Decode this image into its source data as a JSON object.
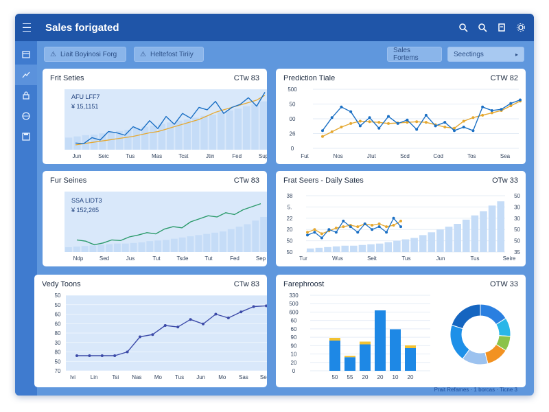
{
  "app": {
    "title": "Sales forigated",
    "footer": "Prait Refames · 1 borcas · Ticne 3"
  },
  "toolbar": {
    "btn1": "Liait Boyinosi Forg",
    "btn2": "Heltefost Tiriiy",
    "btn3": "Sales Fortems",
    "btn4": "Seectings"
  },
  "icons": {
    "titlebar": [
      "search-icon",
      "zoom-icon",
      "bookmark-icon",
      "gear-icon"
    ],
    "sidebar": [
      "calendar-icon",
      "chart-icon",
      "lock-icon",
      "globe-icon",
      "save-icon"
    ]
  },
  "colors": {
    "titlebar": "#1f55a8",
    "line_primary": "#1a6fc4",
    "line_secondary": "#e5a830",
    "line_green": "#2a9a6a",
    "line_purple": "#3c4aa8",
    "bar": "#c5dcf7"
  },
  "panels": {
    "p1": {
      "title": "Frit Seties",
      "tag": "CTw 83",
      "legend1": "AFU LFF7",
      "legend2": "¥ 15,1151"
    },
    "p2": {
      "title": "Prediction Tiale",
      "tag": "CTW 82"
    },
    "p3": {
      "title": "Fur Seines",
      "tag": "CTw 83",
      "legend1": "SSA LIDT3",
      "legend2": "¥ 152,265"
    },
    "p4": {
      "title": "Frat Seers - Daily Sates",
      "tag": "OTw 33"
    },
    "p5": {
      "title": "Vedy Toons",
      "tag": "CTw 83"
    },
    "p6": {
      "title": "Farephroost",
      "tag": "OTW 33"
    }
  },
  "chart_data": [
    {
      "id": "p1",
      "type": "line",
      "x": [
        "Jun",
        "Seic",
        "Tus",
        "Mas",
        "Tcst",
        "Jtin",
        "Fed",
        "Sup"
      ],
      "series": [
        {
          "values": [
            11,
            10,
            20,
            16,
            30,
            28,
            24,
            38,
            32,
            48,
            35,
            55,
            42,
            60,
            52,
            70,
            66,
            80,
            60,
            70,
            75,
            86,
            72,
            95
          ]
        },
        {
          "values": [
            8,
            10,
            12,
            14,
            16,
            18,
            20,
            22,
            25,
            28,
            30,
            34,
            38,
            42,
            46,
            50,
            56,
            62,
            66,
            70,
            74,
            78,
            82,
            90
          ]
        }
      ],
      "bars": [
        20,
        22,
        24,
        25,
        27,
        29,
        31,
        33,
        36,
        38,
        40,
        43,
        45,
        48,
        50,
        53,
        56,
        58,
        62,
        65,
        68,
        72,
        75,
        80
      ],
      "ylim": [
        0,
        100
      ]
    },
    {
      "id": "p2",
      "type": "line",
      "yticks": [
        "0",
        "26",
        "00",
        "50",
        "500"
      ],
      "x": [
        "Fut",
        "Nos",
        "Jtut",
        "Scd",
        "Cod",
        "Tos",
        "Sea"
      ],
      "series": [
        {
          "values": [
            150,
            260,
            350,
            310,
            190,
            260,
            170,
            270,
            210,
            240,
            160,
            280,
            190,
            220,
            150,
            180,
            150,
            350,
            320,
            330,
            380,
            410
          ]
        },
        {
          "values": [
            100,
            140,
            180,
            210,
            230,
            225,
            220,
            210,
            215,
            220,
            225,
            220,
            200,
            180,
            170,
            230,
            260,
            280,
            300,
            320,
            360,
            400
          ]
        }
      ],
      "ylim": [
        0,
        500
      ]
    },
    {
      "id": "p3",
      "type": "line",
      "x": [
        "Ndp",
        "Sed",
        "Jus",
        "Tut",
        "Tsde",
        "Tut",
        "Fed",
        "Sep"
      ],
      "series": [
        {
          "values": [
            20,
            18,
            12,
            15,
            20,
            19,
            25,
            28,
            32,
            30,
            38,
            42,
            40,
            50,
            55,
            60,
            58,
            65,
            62,
            70,
            75,
            80
          ]
        }
      ],
      "bars": [
        8,
        9,
        10,
        11,
        12,
        13,
        14,
        14,
        15,
        16,
        18,
        19,
        20,
        22,
        24,
        26,
        28,
        30,
        32,
        34,
        38,
        42,
        46,
        52,
        58
      ],
      "ylim": [
        0,
        100
      ]
    },
    {
      "id": "p4",
      "type": "line",
      "yticks_left": [
        "38",
        "5.",
        "22",
        "20",
        "50",
        "50"
      ],
      "yticks_right": [
        "50",
        "30",
        "30",
        "50",
        "50",
        "35"
      ],
      "x": [
        "Tur",
        "Wus",
        "Seit",
        "Tus",
        "Jun",
        "Tus",
        "Seire"
      ],
      "series": [
        {
          "values": [
            12,
            14,
            10,
            16,
            14,
            22,
            18,
            14,
            20,
            16,
            18,
            14,
            24,
            18
          ]
        },
        {
          "values": [
            14,
            16,
            13,
            15,
            17,
            18,
            19,
            18,
            20,
            19,
            20,
            18,
            19,
            22
          ]
        }
      ],
      "bars": [
        5,
        6,
        7,
        8,
        9,
        9,
        10,
        11,
        12,
        14,
        16,
        18,
        20,
        24,
        28,
        32,
        36,
        40,
        46,
        52,
        58,
        66,
        72
      ],
      "ylim": [
        0,
        80
      ]
    },
    {
      "id": "p5",
      "type": "line",
      "yticks": [
        "50",
        "50",
        "60",
        "60",
        "80",
        "30",
        "80",
        "50",
        "70"
      ],
      "x": [
        "Ivi",
        "Lin",
        "Tsi",
        "Nas",
        "Mo",
        "Tus",
        "Jun",
        "Mo",
        "Sas",
        "Sep"
      ],
      "series": [
        {
          "values": [
            20,
            20,
            20,
            20,
            25,
            45,
            48,
            60,
            58,
            68,
            62,
            75,
            70,
            78,
            85,
            86
          ]
        }
      ],
      "ylim": [
        0,
        100
      ]
    },
    {
      "id": "p6",
      "type": "bar",
      "yticks": [
        "330",
        "500",
        "600",
        "60",
        "60",
        "90",
        "90",
        "10",
        "20",
        "0"
      ],
      "categories": [
        "50",
        "55",
        "20",
        "20",
        "10",
        "20"
      ],
      "values": [
        40,
        18,
        35,
        80,
        55,
        30
      ],
      "caps": [
        4,
        2,
        4,
        0,
        0,
        4
      ],
      "donut": [
        {
          "value": 16,
          "color": "#2a7fe0"
        },
        {
          "value": 10,
          "color": "#29b6e8"
        },
        {
          "value": 8,
          "color": "#8bc34a"
        },
        {
          "value": 12,
          "color": "#f29222"
        },
        {
          "value": 14,
          "color": "#9cc2ef"
        },
        {
          "value": 20,
          "color": "#1e90e8"
        },
        {
          "value": 20,
          "color": "#1565c0"
        }
      ]
    }
  ]
}
